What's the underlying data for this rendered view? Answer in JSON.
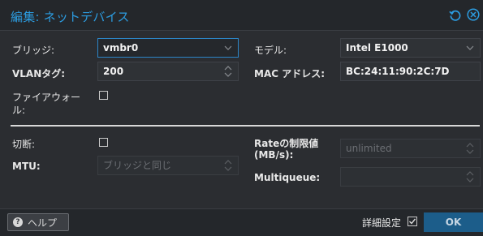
{
  "dialog": {
    "title": "編集: ネットデバイス",
    "reset_icon": "reset-icon",
    "close_icon": "close-icon"
  },
  "form": {
    "bridge": {
      "label": "ブリッジ:",
      "value": "vmbr0"
    },
    "vlan_tag": {
      "label": "VLANタグ:",
      "value": "200"
    },
    "firewall": {
      "label_line1": "ファイアウォー",
      "label_line2": "ル:",
      "checked": false
    },
    "model": {
      "label": "モデル:",
      "value": "Intel E1000"
    },
    "mac_address": {
      "label": "MAC アドレス:",
      "value": "BC:24:11:90:2C:7D"
    },
    "disconnect": {
      "label": "切断:",
      "checked": false
    },
    "mtu": {
      "label": "MTU:",
      "placeholder": "ブリッジと同じ"
    },
    "rate_limit": {
      "label_line1": "Rateの制限値",
      "label_line2": "(MB/s):",
      "placeholder": "unlimited"
    },
    "multiqueue": {
      "label": "Multiqueue:",
      "value": ""
    }
  },
  "footer": {
    "help_label": "ヘルプ",
    "advanced_label": "詳細設定",
    "advanced_checked": true,
    "ok_label": "OK"
  },
  "colors": {
    "accent": "#2c9ce0",
    "ok_button": "#1c5d8a",
    "background": "#2b2d31"
  }
}
